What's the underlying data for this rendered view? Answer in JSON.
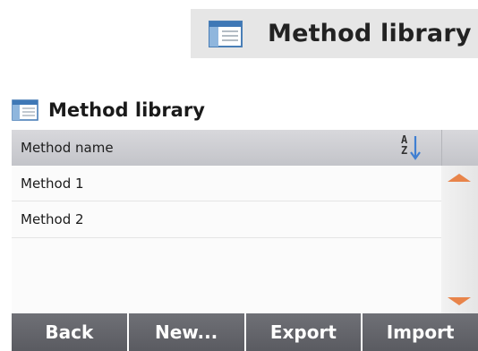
{
  "callout": {
    "title": "Method library",
    "icon": "method-library-icon"
  },
  "panel": {
    "title": "Method library",
    "icon": "method-library-icon"
  },
  "list": {
    "column_header": "Method name",
    "sort_icon": "sort-az-icon",
    "sort_letter_top": "A",
    "sort_letter_bottom": "Z",
    "items": [
      "Method 1",
      "Method 2"
    ]
  },
  "buttons": {
    "back": "Back",
    "new": "New...",
    "export": "Export",
    "import": "Import"
  },
  "colors": {
    "accent_orange": "#e8844a",
    "button_bg": "#646569",
    "header_bg": "#cbccd0",
    "sort_arrow": "#3f7fd2"
  }
}
